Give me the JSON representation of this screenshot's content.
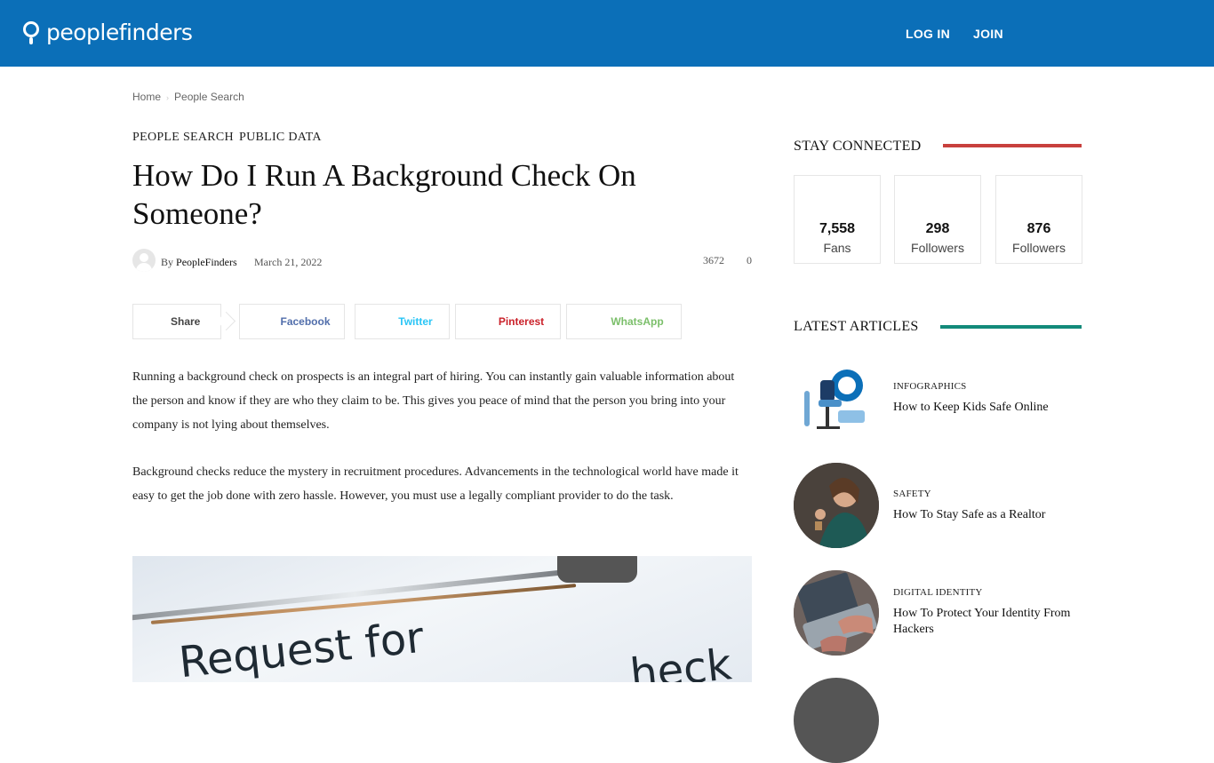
{
  "header": {
    "logo_text": "peoplefinders",
    "login_label": "LOG IN",
    "join_label": "JOIN",
    "search_icon_glyph": "",
    "user_icon_glyph": "",
    "bg_color": "#0b6fb8"
  },
  "breadcrumb": {
    "items": [
      "Home",
      "People Search"
    ],
    "separator": "›"
  },
  "article": {
    "categories": [
      "PEOPLE SEARCH",
      "PUBLIC DATA"
    ],
    "title": "How Do I Run A Background Check On Someone?",
    "by_label": "By",
    "author": "PeopleFinders",
    "date": "March 21, 2022",
    "views_icon": "",
    "views": "3672",
    "comments_icon": "",
    "comments": "0",
    "paragraphs": [
      "Running a background check on prospects is an integral part of hiring. You can instantly gain valuable information about the person and know if they are who they claim to be. This gives you peace of mind that the person you bring into your company is not lying about themselves.",
      "Background checks reduce the mystery in recruitment procedures. Advancements in the technological world have made it easy to get the job done with zero hassle. However, you must use a legally compliant provider to do the task."
    ],
    "hero_text_1": "Request for",
    "hero_text_2": "heck"
  },
  "share": {
    "share_label": "Share",
    "share_icon": "",
    "buttons": [
      {
        "label": "Facebook",
        "icon": "",
        "color": "#516eab"
      },
      {
        "label": "Twitter",
        "icon": "",
        "color": "#29c5f6"
      },
      {
        "label": "Pinterest",
        "icon": "",
        "color": "#ca212a"
      },
      {
        "label": "WhatsApp",
        "icon": "",
        "color": "#7bbf6a"
      }
    ]
  },
  "sidebar": {
    "stay_connected": {
      "heading": "STAY CONNECTED",
      "accent": "#c8403d",
      "boxes": [
        {
          "icon": "",
          "count": "7,558",
          "label": "Fans",
          "color": "#516eab"
        },
        {
          "icon": "",
          "count": "298",
          "label": "Followers",
          "color": "#29c5f6"
        },
        {
          "icon": "",
          "count": "876",
          "label": "Followers",
          "color": "#29c5f6"
        }
      ]
    },
    "latest_articles": {
      "heading": "LATEST ARTICLES",
      "accent": "#138a7a",
      "items": [
        {
          "category": "INFOGRAPHICS",
          "title": "How to Keep Kids Safe Online"
        },
        {
          "category": "SAFETY",
          "title": "How To Stay Safe as a Realtor"
        },
        {
          "category": "DIGITAL IDENTITY",
          "title": "How To Protect Your Identity From Hackers"
        }
      ]
    }
  }
}
